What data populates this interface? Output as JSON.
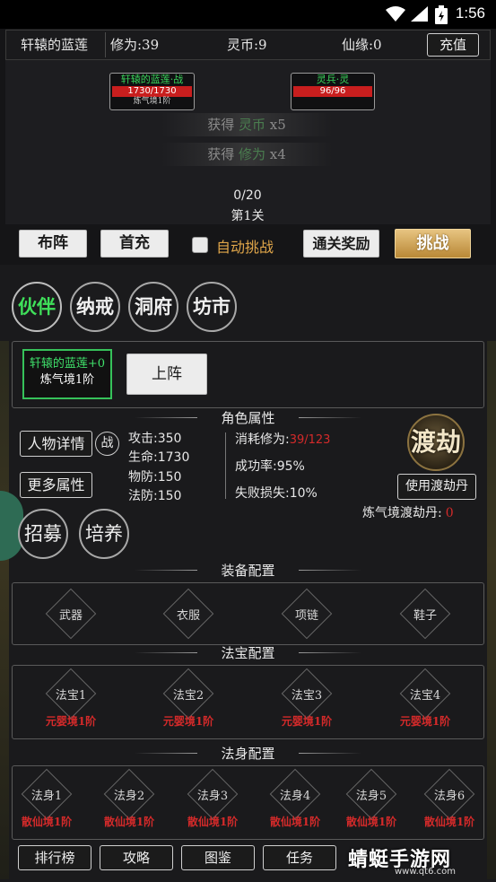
{
  "status_bar": {
    "time": "1:56"
  },
  "top_bar": {
    "player_name": "轩辕的蓝莲",
    "cultivation": "修为:39",
    "spirit_coin": "灵币:9",
    "fate": "仙缘:0",
    "recharge_label": "充值"
  },
  "battle": {
    "player": {
      "name": "轩辕的蓝莲·战",
      "hp": "1730/1730",
      "level": "炼气境1阶"
    },
    "enemy": {
      "name": "灵兵·灵",
      "hp": "96/96"
    },
    "gains": [
      {
        "prefix": "获得 ",
        "item": "灵币",
        "count": " x5"
      },
      {
        "prefix": "获得 ",
        "item": "修为",
        "count": " x4"
      }
    ],
    "progress": "0/20",
    "stage": "第1关"
  },
  "actions": {
    "formation": "布阵",
    "first_recharge": "首充",
    "auto_challenge": "自动挑战",
    "clear_reward": "通关奖励",
    "challenge": "挑战"
  },
  "nav_tabs": [
    "伙伴",
    "纳戒",
    "洞府",
    "坊市"
  ],
  "hero": {
    "card_name": "轩辕的蓝莲+0",
    "card_level": "炼气境1阶",
    "deploy_label": "上阵"
  },
  "attributes": {
    "title": "角色属性",
    "details_btn": "人物详情",
    "battle_tag": "战",
    "more_btn": "更多属性",
    "recruit_btn": "招募",
    "train_btn": "培养",
    "attack": "攻击:350",
    "life": "生命:1730",
    "phys_def": "物防:150",
    "magic_def": "法防:150",
    "cost_label": "消耗修为:",
    "cost_value": "39/123",
    "success_rate": "成功率:95%",
    "fail_loss": "失败损失:10%",
    "dujie_label": "渡劫",
    "use_pill_btn": "使用渡劫丹",
    "pill_label": "炼气境渡劫丹:",
    "pill_count": "0"
  },
  "equipment": {
    "title": "装备配置",
    "slots": [
      "武器",
      "衣服",
      "项链",
      "鞋子"
    ]
  },
  "treasures": {
    "title": "法宝配置",
    "slots": [
      {
        "name": "法宝1",
        "req": "元婴境1阶"
      },
      {
        "name": "法宝2",
        "req": "元婴境1阶"
      },
      {
        "name": "法宝3",
        "req": "元婴境1阶"
      },
      {
        "name": "法宝4",
        "req": "元婴境1阶"
      }
    ]
  },
  "bodies": {
    "title": "法身配置",
    "slots": [
      {
        "name": "法身1",
        "req": "散仙境1阶"
      },
      {
        "name": "法身2",
        "req": "散仙境1阶"
      },
      {
        "name": "法身3",
        "req": "散仙境1阶"
      },
      {
        "name": "法身4",
        "req": "散仙境1阶"
      },
      {
        "name": "法身5",
        "req": "散仙境1阶"
      },
      {
        "name": "法身6",
        "req": "散仙境1阶"
      }
    ]
  },
  "bottom_nav": [
    "排行榜",
    "攻略",
    "图鉴",
    "任务"
  ],
  "watermark": {
    "text": "蜻蜓手游网",
    "sub": "www.qt6.com"
  },
  "colors": {
    "green": "#3fe05a",
    "red": "#d42a2a",
    "gold": "#e7c481"
  },
  "icons": [
    "wifi-icon",
    "signal-icon",
    "battery-icon"
  ]
}
